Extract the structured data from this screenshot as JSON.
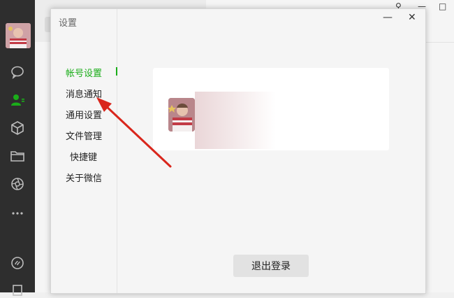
{
  "window": {
    "pin_glyph": "⚲",
    "minimize_glyph": "—",
    "maximize_glyph": "□"
  },
  "sidebar": {
    "icons": [
      "chat-icon",
      "contacts-icon",
      "favorites-icon",
      "files-icon",
      "moments-icon",
      "more-icon",
      "mini-program-icon",
      "menu-icon"
    ],
    "active_icon": "contacts-icon",
    "accent_color": "#1aad19"
  },
  "dialog": {
    "title": "设置",
    "minimize_glyph": "—",
    "close_glyph": "✕",
    "nav": {
      "items": [
        {
          "label": "帐号设置",
          "active": true
        },
        {
          "label": "消息通知",
          "active": false
        },
        {
          "label": "通用设置",
          "active": false
        },
        {
          "label": "文件管理",
          "active": false
        },
        {
          "label": "快捷键",
          "active": false
        },
        {
          "label": "关于微信",
          "active": false
        }
      ]
    },
    "account": {
      "logout_label": "退出登录"
    }
  },
  "annotation": {
    "arrow_color": "#d9261c",
    "points_to": "消息通知"
  }
}
